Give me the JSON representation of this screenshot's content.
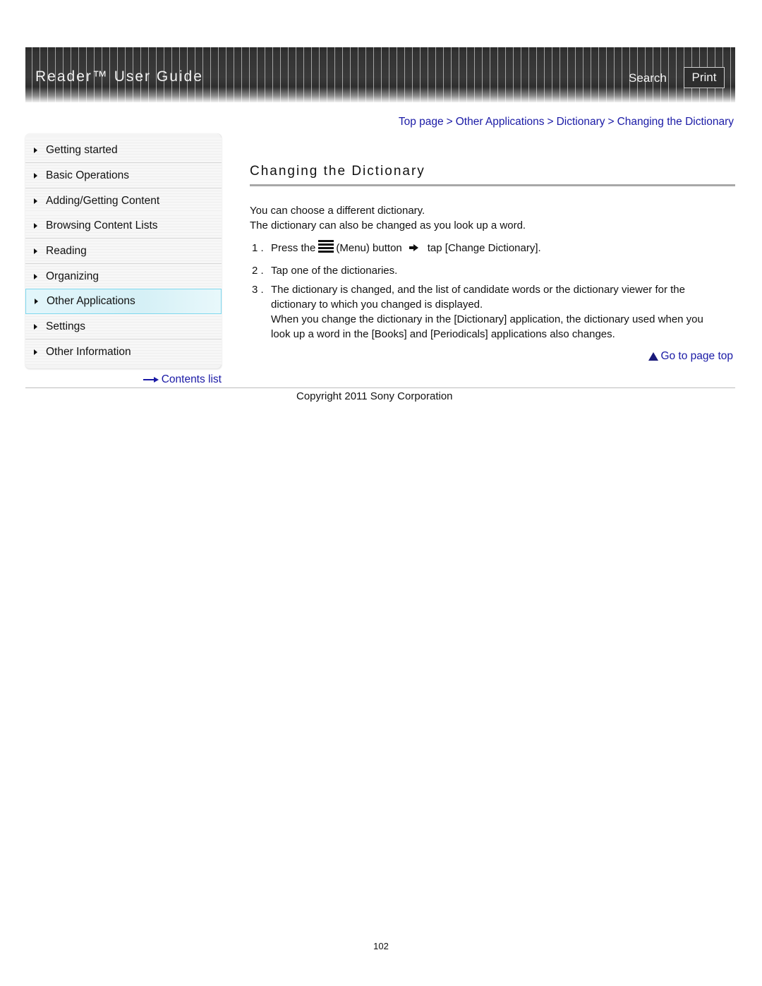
{
  "header": {
    "title": "Reader™ User Guide",
    "search_label": "Search",
    "print_label": "Print"
  },
  "breadcrumb": [
    {
      "label": "Top page"
    },
    {
      "label": "Other Applications"
    },
    {
      "label": "Dictionary"
    },
    {
      "label": "Changing the Dictionary"
    }
  ],
  "breadcrumb_separator": ">",
  "sidebar": {
    "items": [
      {
        "label": "Getting started",
        "active": false
      },
      {
        "label": "Basic Operations",
        "active": false
      },
      {
        "label": "Adding/Getting Content",
        "active": false
      },
      {
        "label": "Browsing Content Lists",
        "active": false
      },
      {
        "label": "Reading",
        "active": false
      },
      {
        "label": "Organizing",
        "active": false
      },
      {
        "label": "Other Applications",
        "active": true
      },
      {
        "label": "Settings",
        "active": false
      },
      {
        "label": "Other Information",
        "active": false
      }
    ],
    "contents_link": "Contents list"
  },
  "main": {
    "title": "Changing the Dictionary",
    "intro": [
      "You can choose a different dictionary.",
      "The dictionary can also be changed as you look up a word."
    ],
    "steps": [
      {
        "num": "1 .",
        "prefix": "Press the",
        "icon": "menu-icon",
        "middle": "(Menu) button",
        "suffix": "tap [Change Dictionary]."
      },
      {
        "num": "2 .",
        "text": "Tap one of the dictionaries."
      },
      {
        "num": "3 .",
        "lines": [
          "The dictionary is changed, and the list of candidate words or the dictionary viewer for the",
          "dictionary to which you changed is displayed.",
          "When you change the dictionary in the [Dictionary] application, the dictionary used when you",
          "look up a word in the [Books] and [Periodicals] applications also changes."
        ]
      }
    ],
    "go_to_top": "Go to page top"
  },
  "footer": {
    "copyright": "Copyright 2011 Sony Corporation",
    "page_number": "102"
  },
  "colors": {
    "link": "#1a1aa6",
    "active_nav_bg": "#d5f0f6",
    "active_nav_border": "#7fd8ee",
    "header_bg": "#333333"
  }
}
